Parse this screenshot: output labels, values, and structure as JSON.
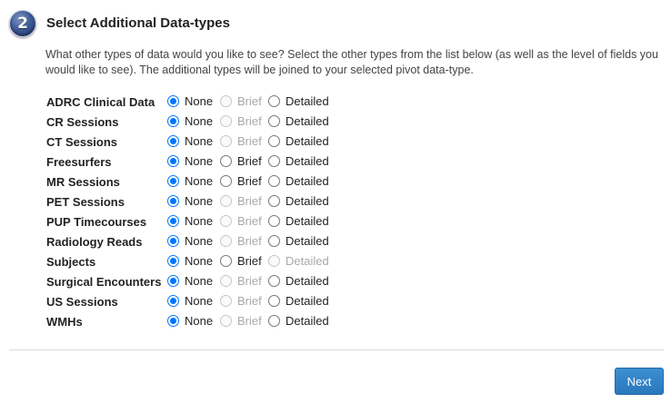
{
  "step": {
    "number": "2",
    "title": "Select Additional Data-types",
    "description": "What other types of data would you like to see? Select the other types from the list below (as well as the level of fields you would like to see). The additional types will be joined to your selected pivot data-type."
  },
  "options": {
    "none": "None",
    "brief": "Brief",
    "detailed": "Detailed"
  },
  "data_types": [
    {
      "label": "ADRC Clinical Data",
      "selected": "none",
      "none_enabled": true,
      "brief_enabled": false,
      "detailed_enabled": true
    },
    {
      "label": "CR Sessions",
      "selected": "none",
      "none_enabled": true,
      "brief_enabled": false,
      "detailed_enabled": true
    },
    {
      "label": "CT Sessions",
      "selected": "none",
      "none_enabled": true,
      "brief_enabled": false,
      "detailed_enabled": true
    },
    {
      "label": "Freesurfers",
      "selected": "none",
      "none_enabled": true,
      "brief_enabled": true,
      "detailed_enabled": true
    },
    {
      "label": "MR Sessions",
      "selected": "none",
      "none_enabled": true,
      "brief_enabled": true,
      "detailed_enabled": true
    },
    {
      "label": "PET Sessions",
      "selected": "none",
      "none_enabled": true,
      "brief_enabled": false,
      "detailed_enabled": true
    },
    {
      "label": "PUP Timecourses",
      "selected": "none",
      "none_enabled": true,
      "brief_enabled": false,
      "detailed_enabled": true
    },
    {
      "label": "Radiology Reads",
      "selected": "none",
      "none_enabled": true,
      "brief_enabled": false,
      "detailed_enabled": true
    },
    {
      "label": "Subjects",
      "selected": "none",
      "none_enabled": true,
      "brief_enabled": true,
      "detailed_enabled": false
    },
    {
      "label": "Surgical Encounters",
      "selected": "none",
      "none_enabled": true,
      "brief_enabled": false,
      "detailed_enabled": true
    },
    {
      "label": "US Sessions",
      "selected": "none",
      "none_enabled": true,
      "brief_enabled": false,
      "detailed_enabled": true
    },
    {
      "label": "WMHs",
      "selected": "none",
      "none_enabled": true,
      "brief_enabled": false,
      "detailed_enabled": true
    }
  ],
  "actions": {
    "next_label": "Next"
  },
  "colors": {
    "accent": "#0075ff",
    "button": "#2a78bd",
    "disabled_text": "#a9a9a9"
  }
}
